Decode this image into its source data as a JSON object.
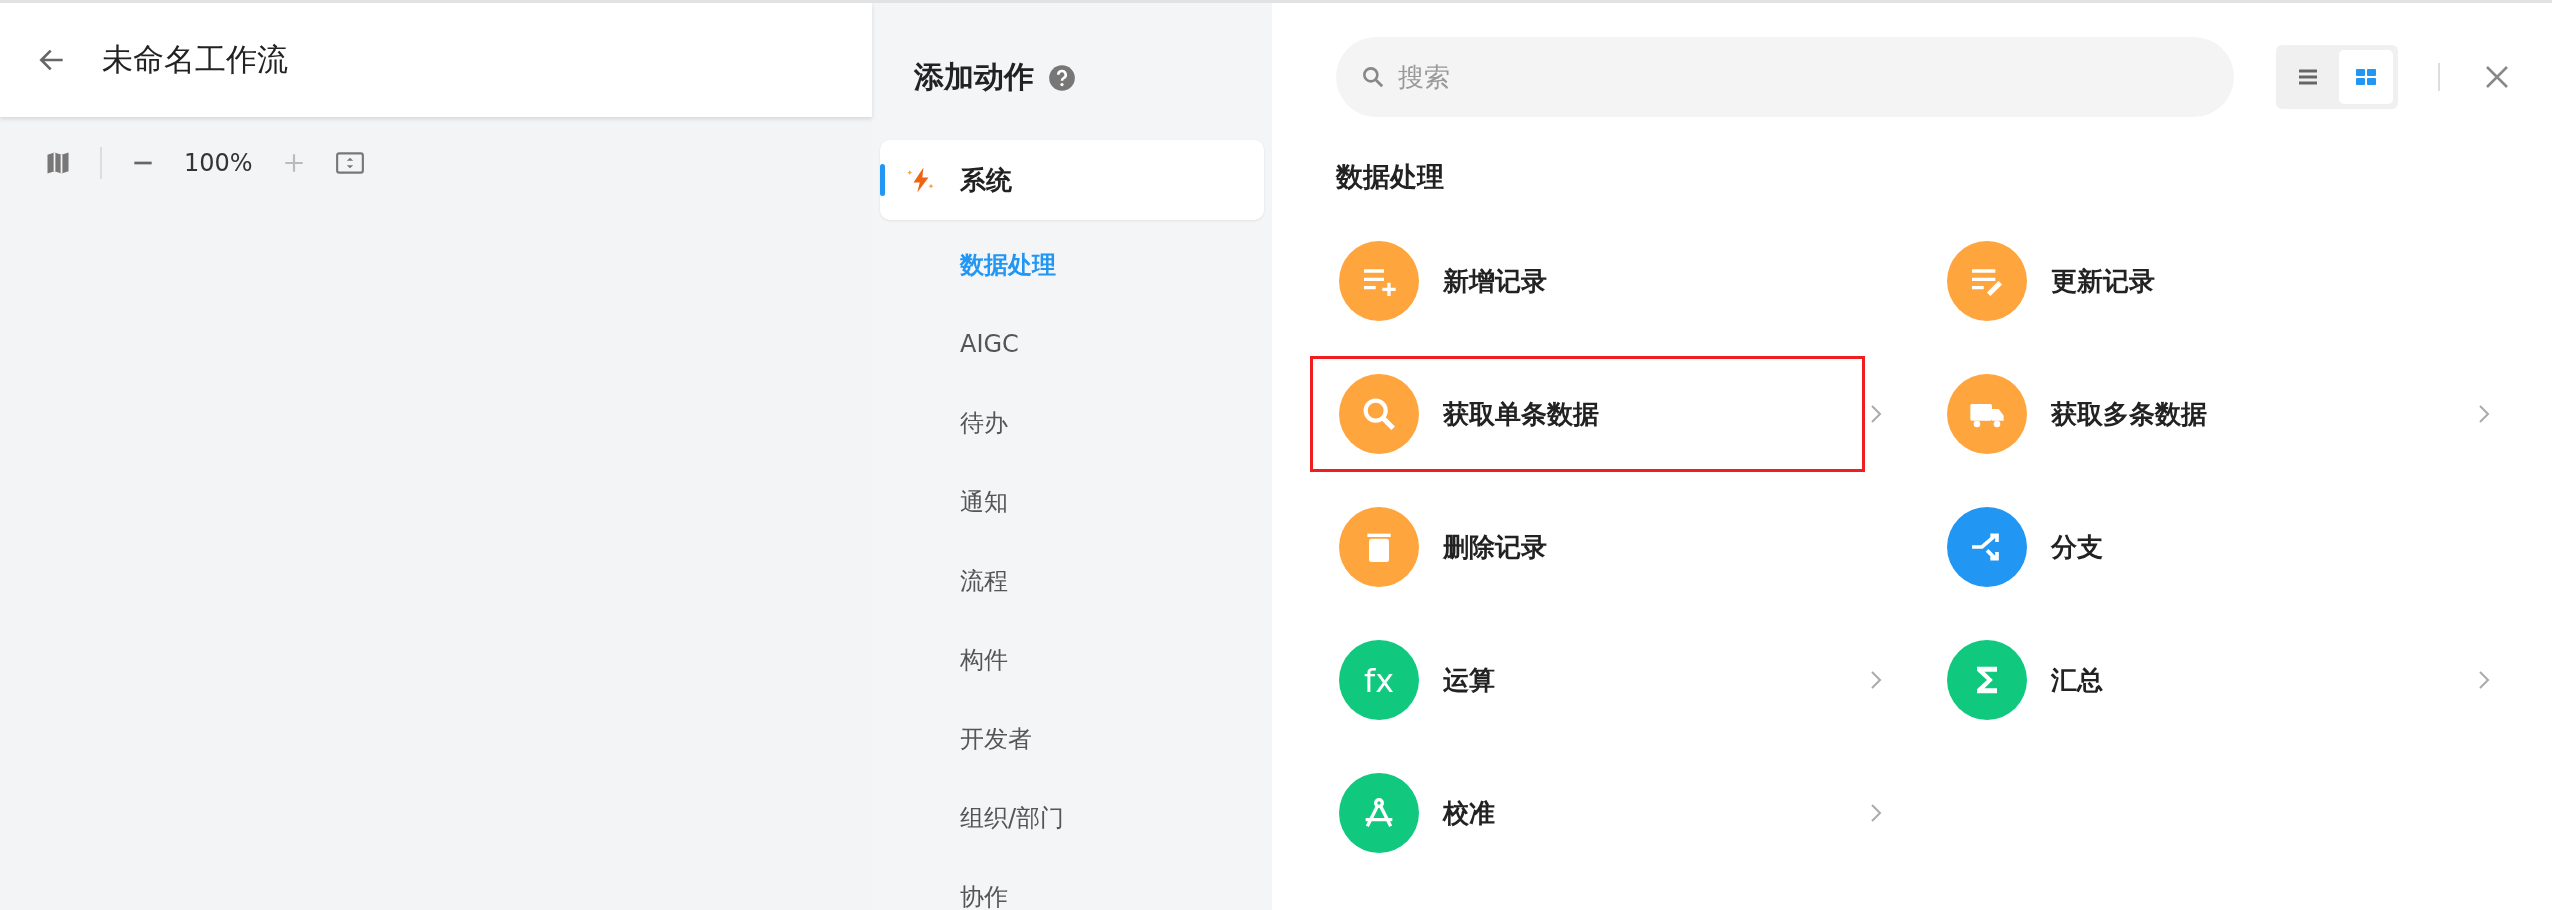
{
  "header": {
    "title": "未命名工作流"
  },
  "toolbar": {
    "zoom": "100%"
  },
  "panel": {
    "title": "添加动作",
    "categories": [
      {
        "label": "系统",
        "selected": true,
        "children": [
          {
            "label": "数据处理",
            "selected": true
          },
          {
            "label": "AIGC",
            "selected": false
          },
          {
            "label": "待办",
            "selected": false
          },
          {
            "label": "通知",
            "selected": false
          },
          {
            "label": "流程",
            "selected": false
          },
          {
            "label": "构件",
            "selected": false
          },
          {
            "label": "开发者",
            "selected": false
          },
          {
            "label": "组织/部门",
            "selected": false
          },
          {
            "label": "协作",
            "selected": false
          }
        ]
      }
    ]
  },
  "search": {
    "placeholder": "搜索"
  },
  "view_modes": [
    {
      "kind": "list",
      "selected": false
    },
    {
      "kind": "grid",
      "selected": true
    }
  ],
  "section": {
    "title": "数据处理",
    "actions": [
      {
        "label": "新增记录",
        "kind": "add",
        "color": "#ffa53d",
        "submenu": false,
        "highlighted": false
      },
      {
        "label": "更新记录",
        "kind": "edit",
        "color": "#ffa53d",
        "submenu": false,
        "highlighted": false
      },
      {
        "label": "获取单条数据",
        "kind": "search",
        "color": "#ffa53d",
        "submenu": true,
        "highlighted": true
      },
      {
        "label": "获取多条数据",
        "kind": "truck",
        "color": "#ffa53d",
        "submenu": true,
        "highlighted": false
      },
      {
        "label": "删除记录",
        "kind": "trash",
        "color": "#ffa53d",
        "submenu": false,
        "highlighted": false
      },
      {
        "label": "分支",
        "kind": "branch",
        "color": "#2196f3",
        "submenu": false,
        "highlighted": false
      },
      {
        "label": "运算",
        "kind": "formula",
        "icon_text": "fx",
        "color": "#10c97f",
        "submenu": true,
        "highlighted": false
      },
      {
        "label": "汇总",
        "kind": "sigma",
        "color": "#10c97f",
        "submenu": true,
        "highlighted": false
      },
      {
        "label": "校准",
        "kind": "compass",
        "color": "#10c97f",
        "submenu": true,
        "highlighted": false
      }
    ]
  }
}
